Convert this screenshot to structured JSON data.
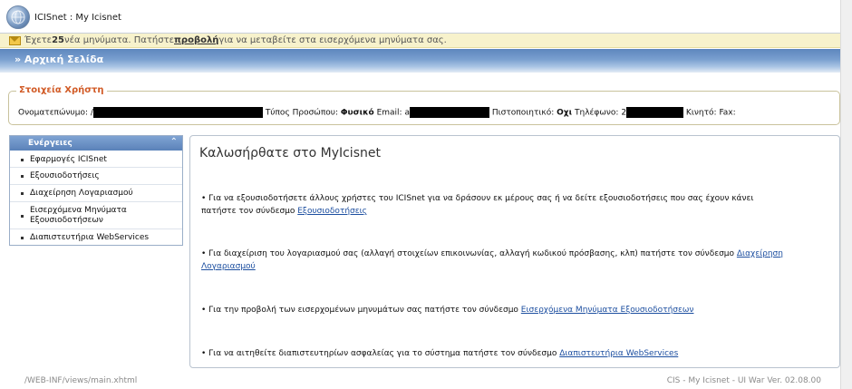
{
  "header": {
    "app_title": "ICISnet : My Icisnet"
  },
  "message_bar": {
    "prefix": "Έχετε",
    "count": "25",
    "middle": "νέα μηνύματα. Πατήστε",
    "link": "προβολή",
    "suffix": "για να μεταβείτε στα εισερχόμενα μηνύματα σας."
  },
  "breadcrumb": {
    "title": "» Αρχική Σελίδα"
  },
  "user_info": {
    "legend": "Στοιχεία Χρήστη",
    "name_label": "Ονοματεπώνυμο:",
    "name_prefix": "/",
    "type_label": "Τύπος Προσώπου:",
    "type_value": "Φυσικό",
    "email_label": "Email:",
    "email_prefix": "a",
    "cert_label": "Πιστοποιητικό:",
    "cert_value": "Οχι",
    "phone_label": "Τηλέφωνο:",
    "phone_prefix": "2",
    "mobile_label": "Κινητό:",
    "fax_label": "Fax:"
  },
  "sidebar": {
    "title": "Ενέργειες",
    "items": [
      {
        "label": "Εφαρμογές ICISnet"
      },
      {
        "label": "Εξουσιοδοτήσεις"
      },
      {
        "label": "Διαχείρηση Λογαριασμού"
      },
      {
        "label": "Εισερχόμενα Μηνύματα Εξουσιοδοτήσεων"
      },
      {
        "label": "Διαπιστευτήρια WebServices"
      }
    ]
  },
  "main": {
    "welcome": "Καλωσήρθατε στο MyIcisnet",
    "paragraphs": [
      {
        "text": "• Για να εξουσιοδοτήσετε άλλους χρήστες του ICISnet για να δράσουν εκ μέρους σας ή να δείτε εξουσιοδοτήσεις που σας έχουν κάνει πατήστε τον σύνδεσμο ",
        "link": "Εξουσιοδοτήσεις"
      },
      {
        "text": "• Για διαχείριση του λογαριασμού σας (αλλαγή στοιχείων επικοινωνίας, αλλαγή κωδικού πρόσβασης, κλπ) πατήστε τον σύνδεσμο ",
        "link": "Διαχείρηση Λογαριασμού"
      },
      {
        "text": "• Για την προβολή των εισερχομένων μηνυμάτων σας πατήστε τον σύνδεσμο ",
        "link": "Εισερχόμενα Μηνύματα Εξουσιοδοτήσεων"
      },
      {
        "text": "• Για να αιτηθείτε διαπιστευτηρίων ασφαλείας για το σύστημα πατήστε τον σύνδεσμο ",
        "link": "Διαπιστευτήρια WebServices"
      }
    ]
  },
  "footer": {
    "path": "/WEB-INF/views/main.xhtml",
    "version": "CIS - My Icisnet - UI War Ver. 02.08.00"
  }
}
